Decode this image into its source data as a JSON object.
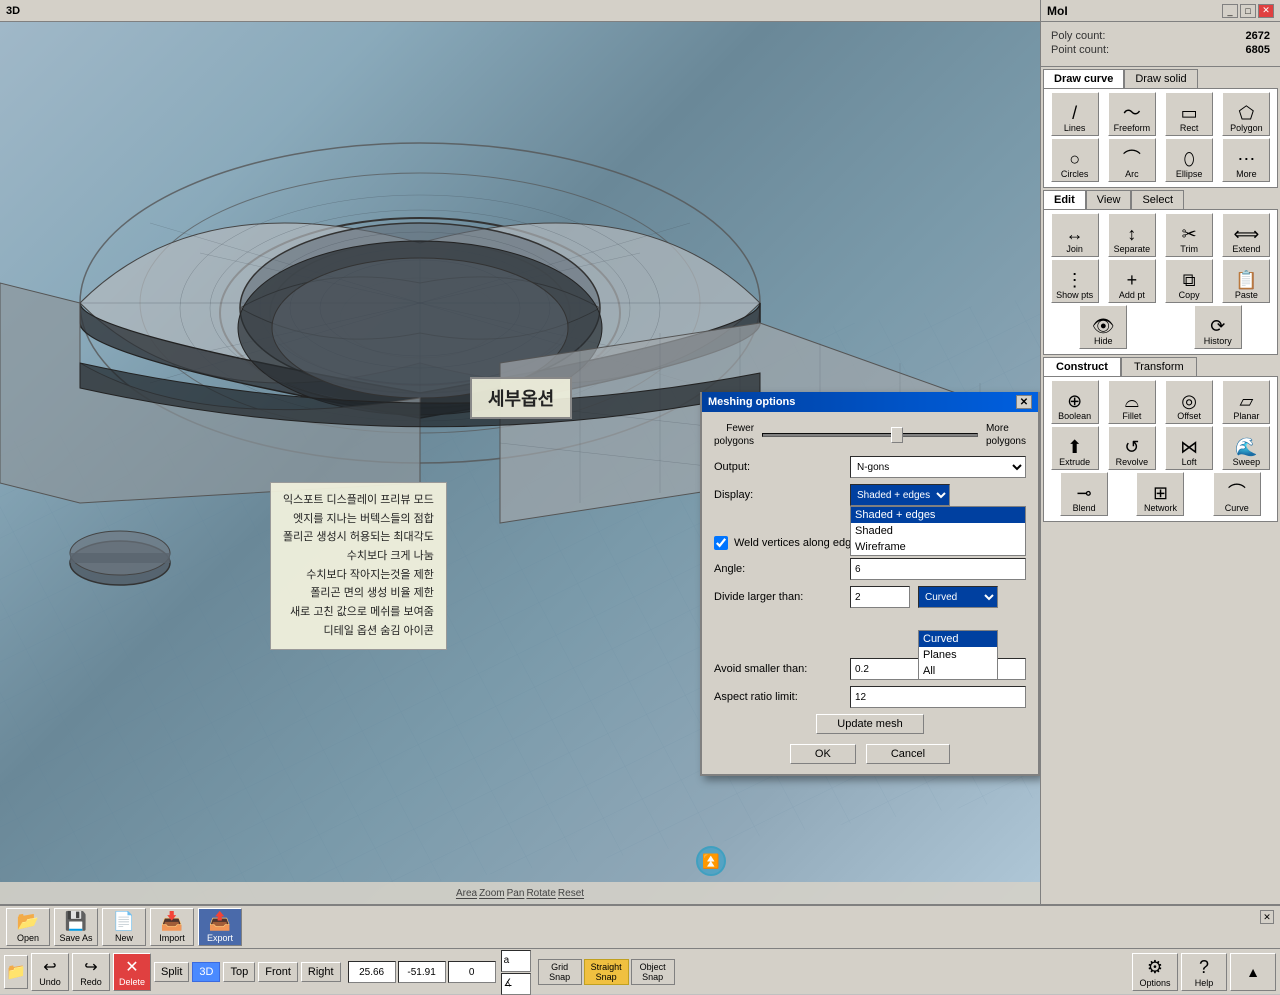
{
  "app": {
    "title": "MoI",
    "label_3d": "3D"
  },
  "stats": {
    "poly_count_label": "Poly count:",
    "poly_count_value": "2672",
    "point_count_label": "Point count:",
    "point_count_value": "6805"
  },
  "draw_tabs": {
    "draw_curve": "Draw curve",
    "draw_solid": "Draw solid"
  },
  "curve_tools": {
    "lines": "Lines",
    "freeform": "Freeform",
    "rect": "Rect",
    "polygon": "Polygon",
    "circles": "Circles",
    "arc": "Arc",
    "ellipse": "Ellipse",
    "more": "More"
  },
  "edit_tabs": {
    "edit": "Edit",
    "view": "View",
    "select": "Select"
  },
  "edit_tools": {
    "join": "Join",
    "separate": "Separate",
    "trim": "Trim",
    "extend": "Extend",
    "show_pts": "Show pts",
    "add_pt": "Add pt",
    "copy": "Copy",
    "paste": "Paste",
    "hide": "Hide",
    "history": "History"
  },
  "construct_tabs": {
    "construct": "Construct",
    "transform": "Transform"
  },
  "construct_tools": {
    "boolean": "Boolean",
    "fillet": "Fillet",
    "offset": "Offset",
    "planar": "Planar",
    "extrude": "Extrude",
    "revolve": "Revolve",
    "loft": "Loft",
    "sweep": "Sweep",
    "blend": "Blend",
    "network": "Network",
    "curve": "Curve"
  },
  "dialog": {
    "title": "Meshing options",
    "slider_fewer": "Fewer\npolygons",
    "slider_more": "More\npolygons",
    "output_label": "Output:",
    "output_value": "N-gons",
    "display_label": "Display:",
    "display_value": "Shaded + edges",
    "display_options": [
      "Shaded + edges",
      "Shaded",
      "Wireframe"
    ],
    "weld_label": "Weld vertices along edges",
    "angle_label": "Angle:",
    "angle_value": "6",
    "divide_label": "Divide larger than:",
    "divide_value": "2",
    "divide_type": "Curved",
    "divide_options": [
      "Curved",
      "Planes",
      "All"
    ],
    "avoid_label": "Avoid smaller than:",
    "avoid_value": "0.2",
    "aspect_label": "Aspect ratio limit:",
    "aspect_value": "12",
    "update_btn": "Update mesh",
    "ok_btn": "OK",
    "cancel_btn": "Cancel"
  },
  "tooltip_items": [
    "익스포트 디스플레이 프리뷰 모드",
    "엣지를 지나는 버텍스들의 점합",
    "폴리곤 생성시 허용되는 최대각도",
    "수치보다 크게 나눔",
    "수치보다 작아지는것을 제한",
    "폴리곤 면의 생성 비율 제한",
    "새로 고친 값으로 메쉬를 보여줌",
    "디테일 옵션 숨김 아이콘"
  ],
  "korean_label": "세부옵션",
  "viewport_toolbar": {
    "area": "Area",
    "zoom": "Zoom",
    "pan": "Pan",
    "rotate": "Rotate",
    "reset": "Reset"
  },
  "file_tools": {
    "open": "Open",
    "save_as": "Save As",
    "new": "New",
    "import": "Import",
    "export": "Export"
  },
  "action_tools": {
    "split": "Split",
    "three_d": "3D",
    "top": "Top",
    "front": "Front",
    "right": "Right",
    "undo": "Undo",
    "redo": "Redo",
    "delete": "Delete"
  },
  "coords": {
    "x": "25.66",
    "y": "-51.91",
    "z": "0",
    "input_a": "a",
    "input_b": "∡"
  },
  "snap_buttons": {
    "grid": "Grid\nSnap",
    "straight": "Straight\nSnap",
    "object": "Object\nSnap"
  },
  "right_buttons": {
    "options": "Options",
    "help": "Help"
  }
}
